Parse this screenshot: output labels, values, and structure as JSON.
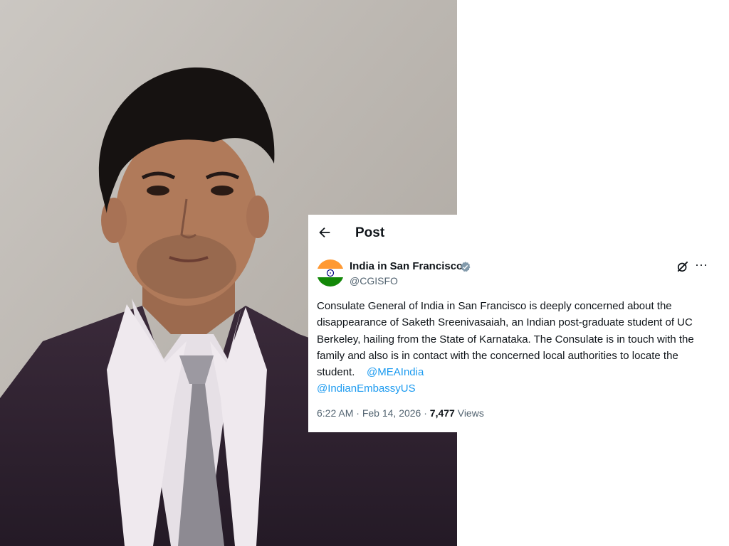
{
  "header": {
    "title": "Post",
    "back_icon": "arrow-left-icon"
  },
  "account": {
    "name": "India in San Francisco",
    "handle": "@CGISFO",
    "avatar": "india-flag-icon",
    "verified_icon": "verified-badge-icon"
  },
  "actions": {
    "grok_icon": "grok-icon",
    "more_label": "···"
  },
  "tweet": {
    "text": "Consulate General of India in San Francisco is deeply concerned about the disappearance of Saketh Sreenivasaiah, an Indian post-graduate student of UC Berkeley, hailing from the State of Karnataka. The Consulate is in touch with the family and also is in contact with the concerned local authorities to locate the student.",
    "mentions": [
      "@MEAIndia",
      "@IndianEmbassyUS"
    ],
    "time": "6:22 AM",
    "date": "Feb 14, 2026",
    "separator": "·",
    "views_count": "7,477",
    "views_label": "Views"
  },
  "colors": {
    "accent": "#1d9bf0",
    "muted": "#536471",
    "text": "#0f1419"
  }
}
